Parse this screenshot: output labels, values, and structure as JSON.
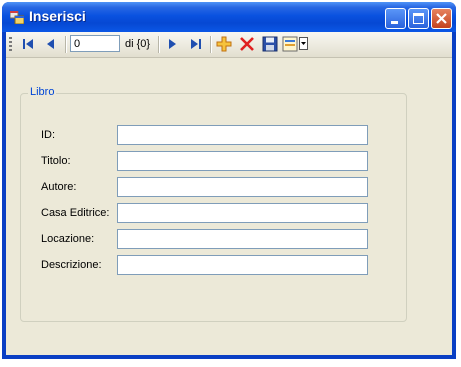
{
  "window": {
    "title": "Inserisci"
  },
  "navigator": {
    "position": "0",
    "count_label": "di {0}"
  },
  "icons": {
    "app": "form-app-icon",
    "move_first": "move-first-icon",
    "move_previous": "move-previous-icon",
    "move_next": "move-next-icon",
    "move_last": "move-last-icon",
    "add": "add-new-icon",
    "delete": "delete-icon",
    "save": "save-icon",
    "dropdown": "data-dropdown-icon"
  },
  "group": {
    "title": "Libro"
  },
  "fields": [
    {
      "label": "ID:",
      "value": ""
    },
    {
      "label": "Titolo:",
      "value": ""
    },
    {
      "label": "Autore:",
      "value": ""
    },
    {
      "label": "Casa Editrice:",
      "value": ""
    },
    {
      "label": "Locazione:",
      "value": ""
    },
    {
      "label": "Descrizione:",
      "value": ""
    }
  ],
  "colors": {
    "title_bar": "#0a52e0",
    "client_bg": "#ece9d8",
    "group_title": "#0046d5",
    "close_button": "#c4421e",
    "add_icon": "#f0a020",
    "delete_icon": "#e02020"
  }
}
